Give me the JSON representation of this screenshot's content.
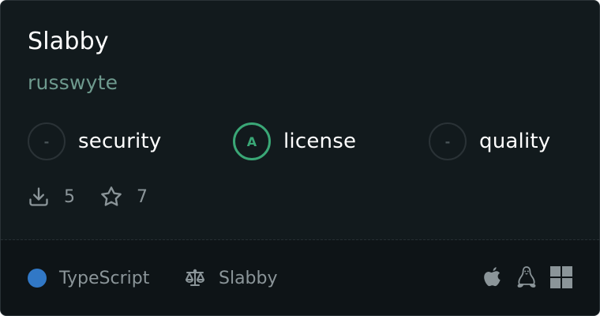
{
  "package": {
    "name": "Slabby",
    "owner": "russwyte"
  },
  "scores": {
    "security": {
      "grade": "-",
      "label": "security"
    },
    "license": {
      "grade": "A",
      "label": "license"
    },
    "quality": {
      "grade": "-",
      "label": "quality"
    }
  },
  "stats": {
    "downloads": "5",
    "stars": "7"
  },
  "footer": {
    "language": "TypeScript",
    "language_color": "#3178c6",
    "license": "Slabby",
    "platforms": [
      "apple-icon",
      "linux-icon",
      "windows-icon"
    ]
  },
  "colors": {
    "card_bg": "#121a1d",
    "footer_bg": "#0e1417",
    "accent_green": "#3aa776",
    "owner_text": "#6e9a8e"
  }
}
